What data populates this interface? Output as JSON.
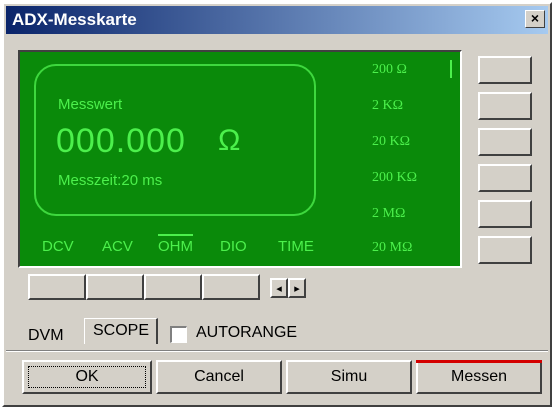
{
  "window": {
    "title": "ADX-Messkarte",
    "close_label": "×"
  },
  "readout": {
    "label": "Messwert",
    "value": "000.000",
    "unit": "Ω",
    "time": "Messzeit:20 ms"
  },
  "modes": [
    "DCV",
    "ACV",
    "OHM",
    "DIO",
    "TIME"
  ],
  "active_mode": "OHM",
  "ranges": [
    "200 Ω",
    "2 KΩ",
    "20 KΩ",
    "200 KΩ",
    "2 MΩ",
    "20 MΩ"
  ],
  "range_buttons_count": 6,
  "bottom_buttons_count": 4,
  "spin": {
    "left": "◂",
    "right": "▸"
  },
  "tabs": {
    "dvm": "DVM",
    "scope": "SCOPE"
  },
  "autorange": {
    "label": "AUTORANGE",
    "checked": false
  },
  "actions": {
    "ok": "OK",
    "cancel": "Cancel",
    "simu": "Simu",
    "messen": "Messen"
  },
  "colors": {
    "display_bg": "#0a8a0a",
    "display_text": "#4cf04c",
    "title_bar": "#0a246a",
    "messen_accent": "#d40000"
  }
}
